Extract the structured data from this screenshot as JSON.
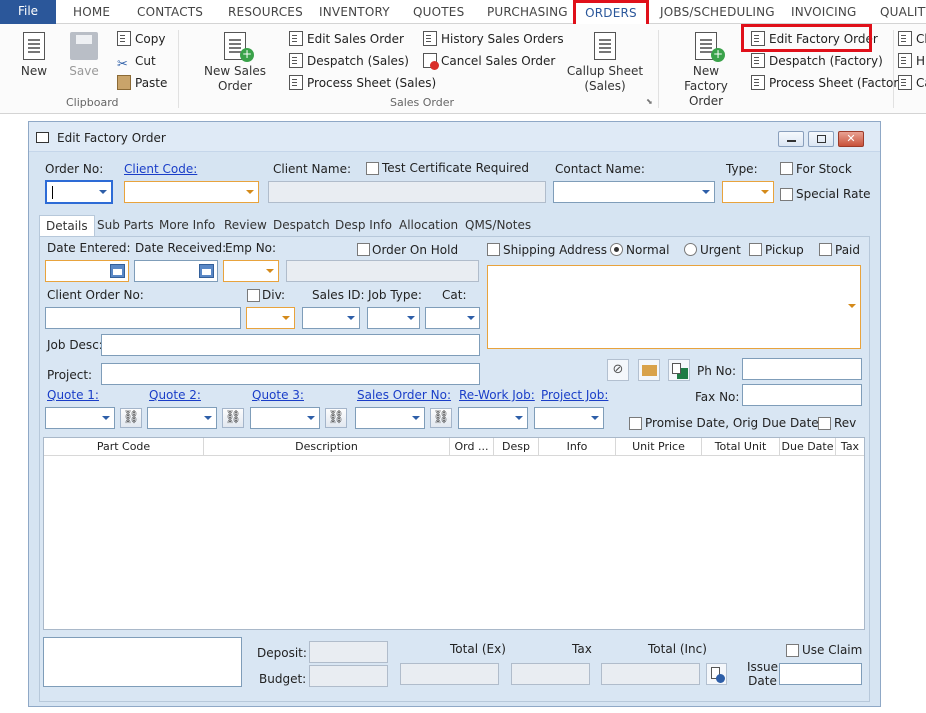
{
  "ribbon_tabs": [
    "File",
    "HOME",
    "CONTACTS",
    "RESOURCES",
    "INVENTORY",
    "QUOTES",
    "PURCHASING",
    "ORDERS",
    "JOBS/SCHEDULING",
    "INVOICING",
    "QUALITY"
  ],
  "clipboard": {
    "new": "New",
    "save": "Save",
    "copy": "Copy",
    "cut": "Cut",
    "paste": "Paste",
    "label": "Clipboard"
  },
  "sales_order": {
    "new_sales_order_l1": "New Sales",
    "new_sales_order_l2": "Order",
    "edit": "Edit Sales Order",
    "despatch": "Despatch (Sales)",
    "process": "Process Sheet (Sales)",
    "history": "History Sales Orders",
    "cancel": "Cancel Sales Order",
    "callup_l1": "Callup Sheet",
    "callup_l2": "(Sales)",
    "label": "Sales Order"
  },
  "factory_order": {
    "new_l1": "New Factory",
    "new_l2": "Order",
    "edit": "Edit Factory Order",
    "despatch": "Despatch (Factory)",
    "process": "Process Sheet (Factory)",
    "extra1": "Ch",
    "extra2": "Hi",
    "extra3": "Ca"
  },
  "window": {
    "title": "Edit Factory Order",
    "order_no": "Order No:",
    "client_code": "Client Code:",
    "client_name": "Client Name:",
    "test_cert": "Test Certificate Required",
    "contact_name": "Contact Name:",
    "type": "Type:",
    "for_stock": "For Stock",
    "special_rate": "Special Rate",
    "tabs": [
      "Details",
      "Sub Parts",
      "More Info",
      "Review",
      "Despatch",
      "Desp Info",
      "Allocation",
      "QMS/Notes"
    ],
    "date_entered": "Date Entered:",
    "date_received": "Date Received:",
    "emp_no": "Emp No:",
    "order_on_hold": "Order On Hold",
    "shipping_address": "Shipping Address",
    "normal": "Normal",
    "urgent": "Urgent",
    "pickup": "Pickup",
    "paid": "Paid",
    "client_order_no": "Client Order No:",
    "div": "Div:",
    "sales_id": "Sales ID:",
    "job_type": "Job Type:",
    "cat": "Cat:",
    "job_desc": "Job Desc:",
    "project": "Project:",
    "ph_no": "Ph No:",
    "fax_no": "Fax No:",
    "quote1": "Quote 1:",
    "quote2": "Quote 2:",
    "quote3": "Quote 3:",
    "sales_order_no": "Sales Order No:",
    "rework_job": "Re-Work Job:",
    "project_job": "Project Job:",
    "promise_date": "Promise Date, Orig Due Date",
    "rev": "Rev",
    "columns": [
      "Part Code",
      "Description",
      "Ord ...",
      "Desp",
      "Info",
      "Unit Price",
      "Total Unit",
      "Due Date",
      "Tax"
    ],
    "deposit": "Deposit:",
    "budget": "Budget:",
    "total_ex": "Total (Ex)",
    "tax": "Tax",
    "total_inc": "Total (Inc)",
    "use_claim": "Use Claim",
    "issue_l1": "Issue",
    "issue_l2": "Date"
  }
}
